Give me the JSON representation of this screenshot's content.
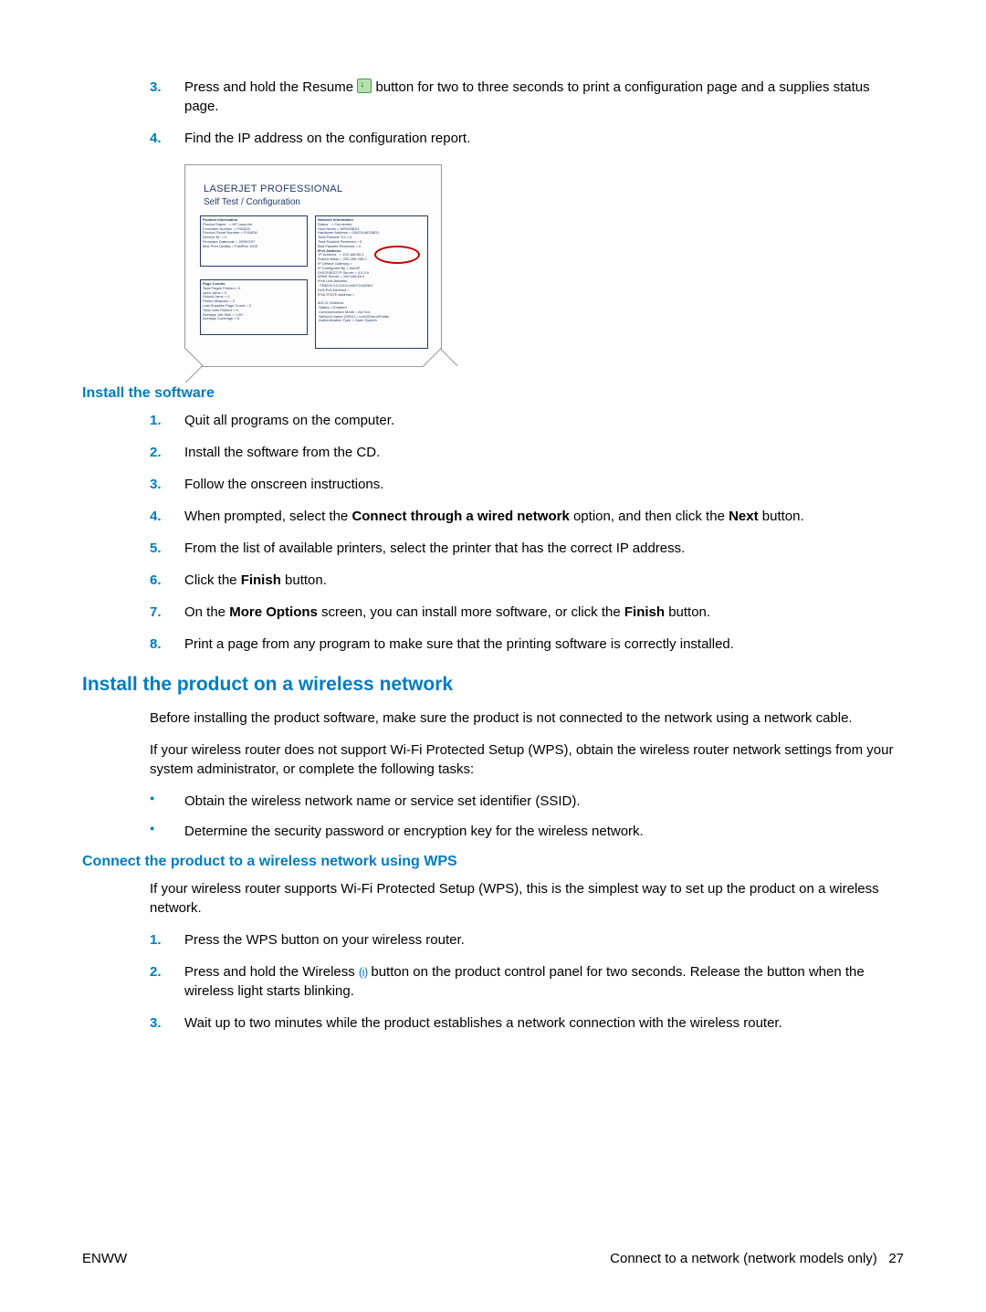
{
  "steps_top": {
    "s3_a": "Press and hold the Resume ",
    "s3_b": " button for two to three seconds to print a configuration page and a supplies status page.",
    "s4": "Find the IP address on the configuration report."
  },
  "figure": {
    "title": "LASERJET PROFESSIONAL",
    "subtitle": "Self Test / Configuration",
    "productinfo_h": "Product Information",
    "netinfo_h": "Network Information",
    "pagecounts_h": "Page Counts",
    "ipv4_label": "IPv4 Address",
    "ip_value": "= 192.168.69.3"
  },
  "install_sw": {
    "heading": "Install the software",
    "s1": "Quit all programs on the computer.",
    "s2": "Install the software from the CD.",
    "s3": "Follow the onscreen instructions.",
    "s4_a": "When prompted, select the ",
    "s4_b": "Connect through a wired network",
    "s4_c": " option, and then click the ",
    "s4_d": "Next",
    "s4_e": " button.",
    "s5": "From the list of available printers, select the printer that has the correct IP address.",
    "s6_a": "Click the ",
    "s6_b": "Finish",
    "s6_c": " button.",
    "s7_a": "On the ",
    "s7_b": "More Options",
    "s7_c": " screen, you can install more software, or click the ",
    "s7_d": "Finish",
    "s7_e": " button.",
    "s8": "Print a page from any program to make sure that the printing software is correctly installed."
  },
  "wireless": {
    "heading": "Install the product on a wireless network",
    "p1": "Before installing the product software, make sure the product is not connected to the network using a network cable.",
    "p2": "If your wireless router does not support Wi-Fi Protected Setup (WPS), obtain the wireless router network settings from your system administrator, or complete the following tasks:",
    "b1": "Obtain the wireless network name or service set identifier (SSID).",
    "b2": "Determine the security password or encryption key for the wireless network."
  },
  "wps": {
    "heading": "Connect the product to a wireless network using WPS",
    "p1": "If your wireless router supports Wi-Fi Protected Setup (WPS), this is the simplest way to set up the product on a wireless network.",
    "s1": "Press the WPS button on your wireless router.",
    "s2_a": "Press and hold the Wireless ",
    "s2_b": " button on the product control panel for two seconds. Release the button when the wireless light starts blinking.",
    "s3": "Wait up to two minutes while the product establishes a network connection with the wireless router."
  },
  "footer": {
    "left": "ENWW",
    "right_text": "Connect to a network (network models only)",
    "page": "27"
  },
  "nums": {
    "n1": "1.",
    "n2": "2.",
    "n3": "3.",
    "n4": "4.",
    "n5": "5.",
    "n6": "6.",
    "n7": "7.",
    "n8": "8."
  }
}
